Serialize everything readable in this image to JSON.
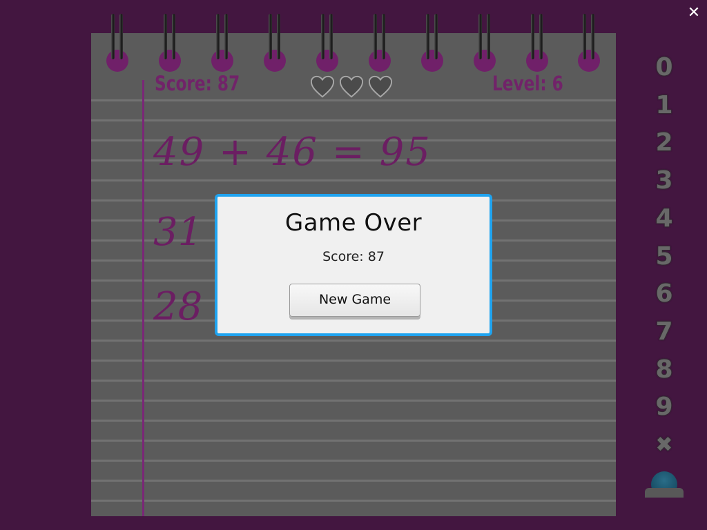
{
  "hud": {
    "score_text": "Score: 87",
    "level_text": "Level: 6",
    "lives_icons": [
      "heart-icon",
      "heart-icon",
      "heart-icon"
    ]
  },
  "equations": [
    {
      "text": "49 + 46 = 95"
    },
    {
      "text": "31"
    },
    {
      "text": "28"
    }
  ],
  "faint_operators": [
    "+",
    "+"
  ],
  "dialog": {
    "title": "Game Over",
    "score_text": "Score: 87",
    "new_game_label": "New Game"
  },
  "keypad": {
    "keys": [
      "0",
      "1",
      "2",
      "3",
      "4",
      "5",
      "6",
      "7",
      "8",
      "9",
      "✖"
    ],
    "submit_icon": "bell-icon"
  },
  "close_icon": "close-icon",
  "colors": {
    "background": "#431640",
    "accent_text": "#712369",
    "dialog_border": "#1fa3ef",
    "paper": "#5b5b5b"
  }
}
